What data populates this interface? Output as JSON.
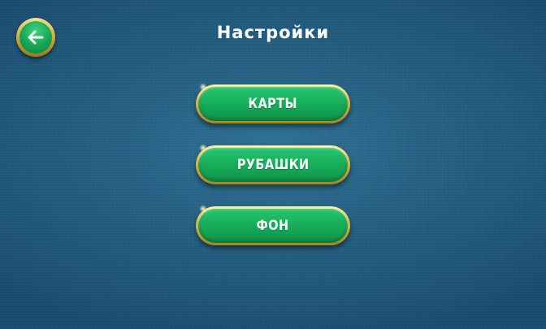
{
  "header": {
    "title": "Настройки"
  },
  "menu": {
    "cards_label": "КАРТЫ",
    "backs_label": "РУБАШКИ",
    "background_label": "ФОН"
  },
  "colors": {
    "background": "#245f82",
    "button_green": "#17ad5b",
    "button_gold": "#e0bb45",
    "text": "#ffffff"
  },
  "icons": {
    "back": "arrow-left-icon"
  }
}
